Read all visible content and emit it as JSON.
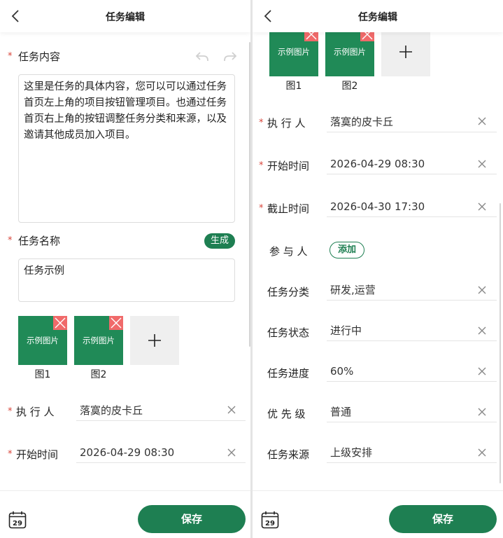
{
  "header": {
    "title": "任务编辑"
  },
  "left": {
    "content_label": "任务内容",
    "content_text": "这里是任务的具体内容，您可以可以通过任务首页左上角的项目按钮管理项目。也通过任务首页右上角的按钮调整任务分类和来源，以及邀请其他成员加入项目。",
    "name_label": "任务名称",
    "generate_label": "生成",
    "name_value": "任务示例",
    "images": [
      {
        "text": "示例图片",
        "caption": "图1"
      },
      {
        "text": "示例图片",
        "caption": "图2"
      }
    ],
    "fields": [
      {
        "label": "执 行 人",
        "value": "落寞的皮卡丘"
      },
      {
        "label": "开始时间",
        "value": "2026-04-29 08:30"
      }
    ]
  },
  "right": {
    "images": [
      {
        "text": "示例图片",
        "caption": "图1"
      },
      {
        "text": "示例图片",
        "caption": "图2"
      }
    ],
    "fields": [
      {
        "label": "执 行 人",
        "value": "落寞的皮卡丘"
      },
      {
        "label": "开始时间",
        "value": "2026-04-29 08:30"
      },
      {
        "label": "截止时间",
        "value": "2026-04-30 17:30"
      },
      {
        "label": "参 与 人",
        "value": ""
      },
      {
        "label": "任务分类",
        "value": "研发,运营"
      },
      {
        "label": "任务状态",
        "value": "进行中"
      },
      {
        "label": "任务进度",
        "value": "60%"
      },
      {
        "label": "优 先 级",
        "value": "普通"
      },
      {
        "label": "任务来源",
        "value": "上级安排"
      }
    ],
    "add_participant_label": "添加"
  },
  "footer": {
    "calendar_day": "29",
    "save_label": "保存"
  },
  "colors": {
    "primary": "#1e7f52",
    "required_star": "#d8453a",
    "image_tile": "#208a57",
    "delete_badge": "#f06a6a"
  },
  "required_mark": "*",
  "plus_symbol": "+"
}
